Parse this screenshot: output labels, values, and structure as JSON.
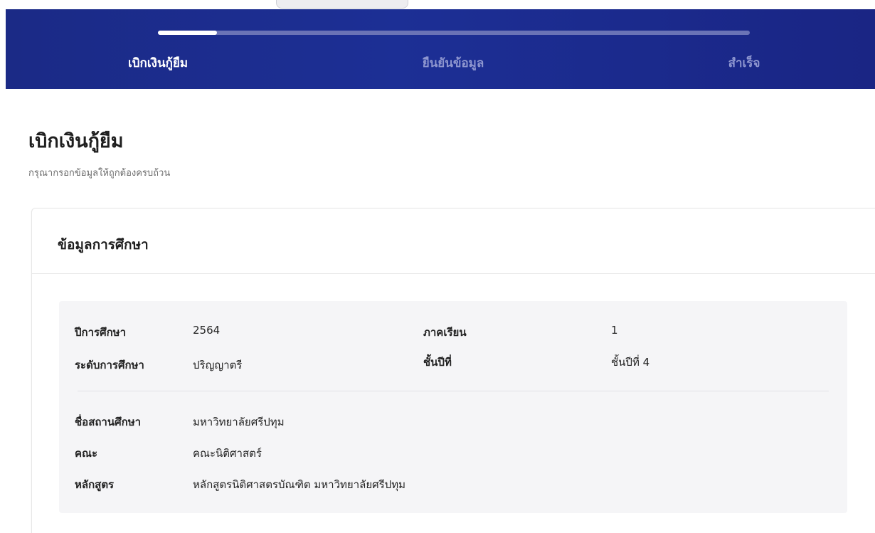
{
  "stepper": {
    "progress_fraction": 0.1,
    "steps": [
      {
        "label": "เบิกเงินกู้ยืม",
        "active": true
      },
      {
        "label": "ยืนยันข้อมูล",
        "active": false
      },
      {
        "label": "สำเร็จ",
        "active": false
      }
    ]
  },
  "page": {
    "title": "เบิกเงินกู้ยืม",
    "subtitle": "กรุณากรอกข้อมูลให้ถูกต้องครบถ้วน"
  },
  "card": {
    "title": "ข้อมูลการศึกษา",
    "academic_year": {
      "label": "ปีการศึกษา",
      "value": "2564"
    },
    "semester": {
      "label": "ภาคเรียน",
      "value": "1"
    },
    "education_level": {
      "label": "ระดับการศึกษา",
      "value": "ปริญญาตรี"
    },
    "year_level": {
      "label": "ชั้นปีที่",
      "value": "ชั้นปีที่ 4"
    },
    "institution": {
      "label": "ชื่อสถานศึกษา",
      "value": "มหาวิทยาลัยศรีปทุม"
    },
    "faculty": {
      "label": "คณะ",
      "value": "คณะนิติศาสตร์"
    },
    "program": {
      "label": "หลักสูตร",
      "value": "หลักสูตรนิติศาสตรบัณฑิต มหาวิทยาลัยศรีปทุม"
    }
  }
}
